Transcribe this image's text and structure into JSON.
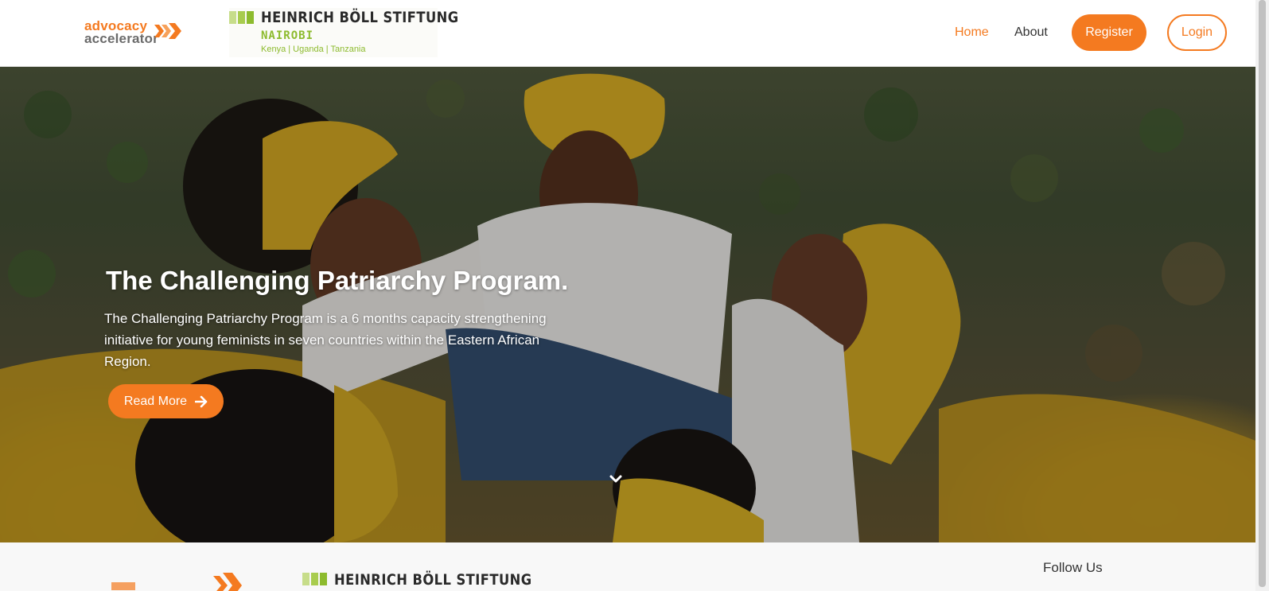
{
  "header": {
    "aa_logo": {
      "line1": "advocacy",
      "line2": "accelerator"
    },
    "partner_logo": {
      "title": "HEINRICH BÖLL STIFTUNG",
      "city": "NAIROBI",
      "countries": "Kenya | Uganda | Tanzania"
    },
    "nav": {
      "home": "Home",
      "about": "About",
      "register": "Register",
      "login": "Login"
    }
  },
  "hero": {
    "title": "The Challenging Patriarchy Program.",
    "description": "The Challenging Patriarchy Program is a 6 months capacity strengthening initiative for young feminists in seven countries within the Eastern African Region.",
    "read_more": "Read More",
    "scroll_icon": "chevron-down-icon",
    "arrow_icon": "arrow-right-icon"
  },
  "footer": {
    "follow_us": "Follow Us",
    "partner_title": "HEINRICH BÖLL STIFTUNG"
  },
  "colors": {
    "accent": "#f47a20",
    "partner_green": "#8dbb2e",
    "text_dark": "#333333",
    "white": "#ffffff"
  }
}
